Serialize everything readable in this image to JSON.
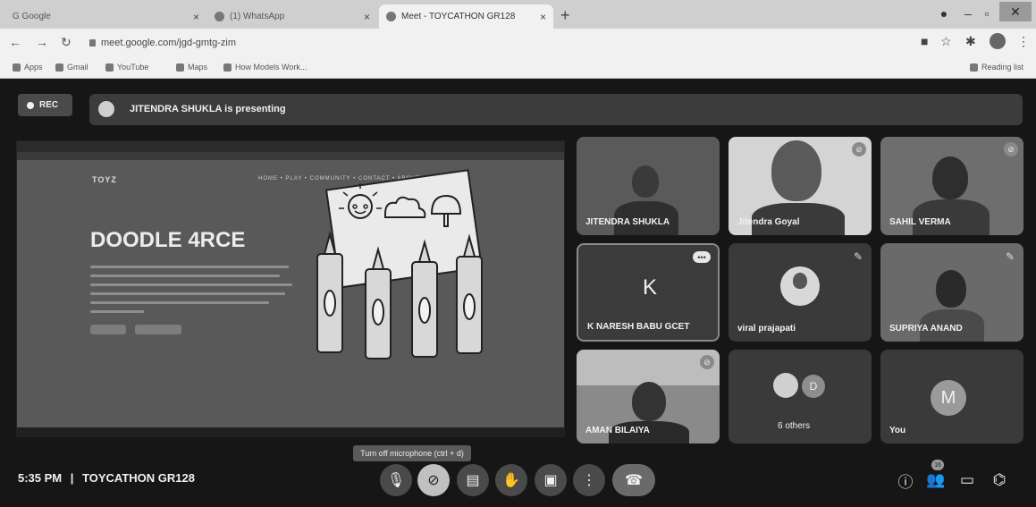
{
  "browser": {
    "tabs": [
      {
        "title": "G Google",
        "active": false
      },
      {
        "title": "(1) WhatsApp",
        "active": false
      },
      {
        "title": "Meet - TOYCATHON GR128",
        "active": true
      }
    ],
    "url": "meet.google.com/jgd-gmtg-zim",
    "bookmarks": [
      "Apps",
      "Gmail",
      "YouTube",
      "Maps",
      "How Models Work..."
    ],
    "reading_list": "Reading list"
  },
  "meet": {
    "rec_label": "REC",
    "presenting_text": "JITENDRA SHUKLA is presenting",
    "shared_screen": {
      "logo": "TOYZ",
      "nav": "HOME  •  PLAY  •  COMMUNITY  •  CONTACT  •  ABOUT  •  SIGNUP",
      "headline": "DOODLE 4RCE"
    },
    "participants": [
      {
        "name": "JITENDRA SHUKLA"
      },
      {
        "name": "Jitendra Goyal"
      },
      {
        "name": "SAHIL VERMA"
      },
      {
        "name": "K NARESH BABU GCET",
        "initial": "K"
      },
      {
        "name": "viral prajapati"
      },
      {
        "name": "SUPRIYA ANAND"
      },
      {
        "name": "AMAN BILAIYA"
      },
      {
        "name": "6 others",
        "initial": "D"
      },
      {
        "name": "You",
        "initial": "M"
      }
    ],
    "bottom": {
      "time": "5:35 PM",
      "separator": "|",
      "meeting_name": "TOYCATHON GR128",
      "tooltip": "Turn off microphone (ctrl + d)",
      "people_count": "16"
    }
  },
  "colors": {
    "meet_bg": "#161616",
    "tile_bg": "#3a3a3a",
    "chrome_bg": "#f1f1f1"
  }
}
